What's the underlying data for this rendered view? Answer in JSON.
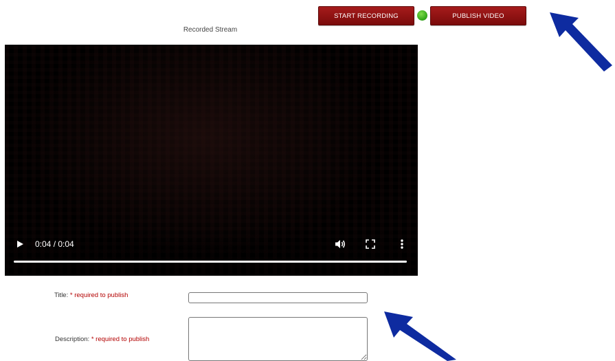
{
  "toolbar": {
    "start_recording_label": "START RECORDING",
    "publish_video_label": "PUBLISH VIDEO",
    "button_color": "#8b1010",
    "status_dot_color": "#3bb21e"
  },
  "stream": {
    "caption": "Recorded Stream"
  },
  "player": {
    "time_display": "0:04 / 0:04",
    "progress_fraction": 1.0,
    "play_icon": "play-icon",
    "volume_icon": "volume-icon",
    "fullscreen_icon": "fullscreen-icon",
    "more_icon": "more-vert-icon"
  },
  "form": {
    "title_label": "Title:",
    "title_required": "* required to publish",
    "title_value": "",
    "description_label": "Description:",
    "description_required": "* required to publish",
    "description_value": ""
  },
  "annotations": {
    "arrow_color": "#0e2ba0"
  }
}
